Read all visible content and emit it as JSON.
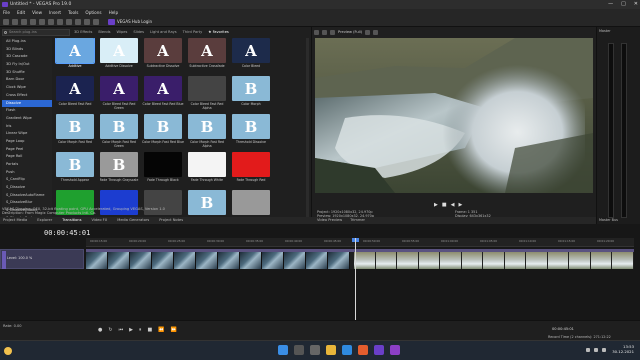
{
  "window": {
    "title": "Untitled * - VEGAS Pro 19.0",
    "controls": [
      "—",
      "□",
      "✕"
    ]
  },
  "menu": [
    "File",
    "Edit",
    "View",
    "Insert",
    "Tools",
    "Options",
    "Help"
  ],
  "hub": {
    "label": "VEGAS Hub Login"
  },
  "fx_browser": {
    "search_placeholder": "Search plug-ins",
    "filter_tabs": [
      "3D Effects",
      "Blends",
      "Wipes",
      "Slides",
      "Light and Rays",
      "Third Party",
      "★ Favorites"
    ],
    "tree": [
      "All Plug-ins",
      "3D Blinds",
      "3D Cascade",
      "3D Fly In/Out",
      "3D Shuffle",
      "Barn Door",
      "Clock Wipe",
      "Cross Effect",
      "Dissolve",
      "Flash",
      "Gradient Wipe",
      "Iris",
      "Linear Wipe",
      "Page Loop",
      "Page Peel",
      "Page Roll",
      "Portals",
      "Push",
      "S_CardFlip",
      "S_Dissolve",
      "S_DissolveAutoFlame",
      "S_DissolveBlur",
      "S_DissolveBubble",
      "S_DissolveFast"
    ],
    "selected_tree_item": "Dissolve",
    "thumbnails": [
      {
        "label": "Additive",
        "glyph": "A",
        "color": "#6aa7e0"
      },
      {
        "label": "Additive Dissolve",
        "glyph": "A",
        "color": "#d9eef7"
      },
      {
        "label": "Subtractive Dissolve",
        "glyph": "A",
        "color": "#5a3d3d"
      },
      {
        "label": "Subtractive Crossfade",
        "glyph": "A",
        "color": "#5a3d3d"
      },
      {
        "label": "Color Bleed",
        "glyph": "A",
        "color": "#1d2b4b"
      },
      {
        "label": "Color Bleed Fast Red",
        "glyph": "A",
        "color": "#1b2350"
      },
      {
        "label": "Color Bleed Fast Red Green",
        "glyph": "A",
        "color": "#3a1e6a"
      },
      {
        "label": "Color Bleed Fast Red Blue",
        "glyph": "A",
        "color": "#3a1e6a"
      },
      {
        "label": "Color Bleed Fast Red Alpha",
        "glyph": "",
        "color": "#444"
      },
      {
        "label": "Color Morph",
        "glyph": "B",
        "color": "#8ab9d6"
      },
      {
        "label": "Color Morph Fast Red",
        "glyph": "B",
        "color": "#8ab9d6"
      },
      {
        "label": "Color Morph Fast Red Green",
        "glyph": "B",
        "color": "#8ab9d6"
      },
      {
        "label": "Color Morph Fast Red Blue",
        "glyph": "B",
        "color": "#8ab9d6"
      },
      {
        "label": "Color Morph Fast Red Alpha",
        "glyph": "B",
        "color": "#8ab9d6"
      },
      {
        "label": "Threshold Dissolve",
        "glyph": "B",
        "color": "#8ab9d6"
      },
      {
        "label": "Threshold Appear",
        "glyph": "B",
        "color": "#8ab9d6"
      },
      {
        "label": "Fade Through Grayscale",
        "glyph": "B",
        "color": "#9a9a9a"
      },
      {
        "label": "Fade Through Black",
        "glyph": "",
        "color": "#050505"
      },
      {
        "label": "Fade Through White",
        "glyph": "",
        "color": "#f4f4f4"
      },
      {
        "label": "Fade Through Red",
        "glyph": "",
        "color": "#e21b1b"
      },
      {
        "label": "",
        "glyph": "",
        "color": "#1fa02f"
      },
      {
        "label": "",
        "glyph": "",
        "color": "#1c3dd0"
      },
      {
        "label": "",
        "glyph": "",
        "color": "#444"
      },
      {
        "label": "",
        "glyph": "B",
        "color": "#8ab9d6"
      },
      {
        "label": "",
        "glyph": "",
        "color": "#999"
      }
    ],
    "status_line1": "VEGAS Dissolve: OFX, 32-bit floating point, GPU Accelerated, Grouping VEGAS, Version 1.0",
    "status_line2": "Description: From Magix Computer Products Intl. Co."
  },
  "panel_tabs": [
    "Project Media",
    "Explorer",
    "Transitions",
    "Video FX",
    "Media Generators",
    "Project Notes"
  ],
  "preview": {
    "mode": "Preview (Full)",
    "info": {
      "project": "Project:   1920x1080x32, 24.970p",
      "preview": "Preview:   1920x1080x32, 24.970p",
      "display": "Display:   1920x1080x32, 24.970p",
      "frame": "Frame:     1 351",
      "display2": "Display:   643x361x32"
    }
  },
  "preview_tabs": [
    "Video Preview",
    "Trimmer"
  ],
  "master": {
    "label": "Master Bus",
    "top": "Master"
  },
  "timeline": {
    "timecode": "00:00:45:01",
    "ruler": [
      "00:00:15:00",
      "00:00:20:00",
      "00:00:25:00",
      "00:00:30:00",
      "00:00:35:00",
      "00:00:40:00",
      "00:00:45:00",
      "00:00:50:00",
      "00:00:55:00",
      "00:01:00:00",
      "00:01:05:00",
      "00:01:10:00",
      "00:01:15:00",
      "00:01:20:00"
    ],
    "track_level": "Level: 100.0 %",
    "rate": "Rate: 0.00",
    "end_timecode": "00:00:45:01",
    "record_time": "Record Time (2 channels): 271:12:22"
  },
  "taskbar": {
    "time": "13:53",
    "date": "30.12.2021",
    "lang": "ENG"
  }
}
